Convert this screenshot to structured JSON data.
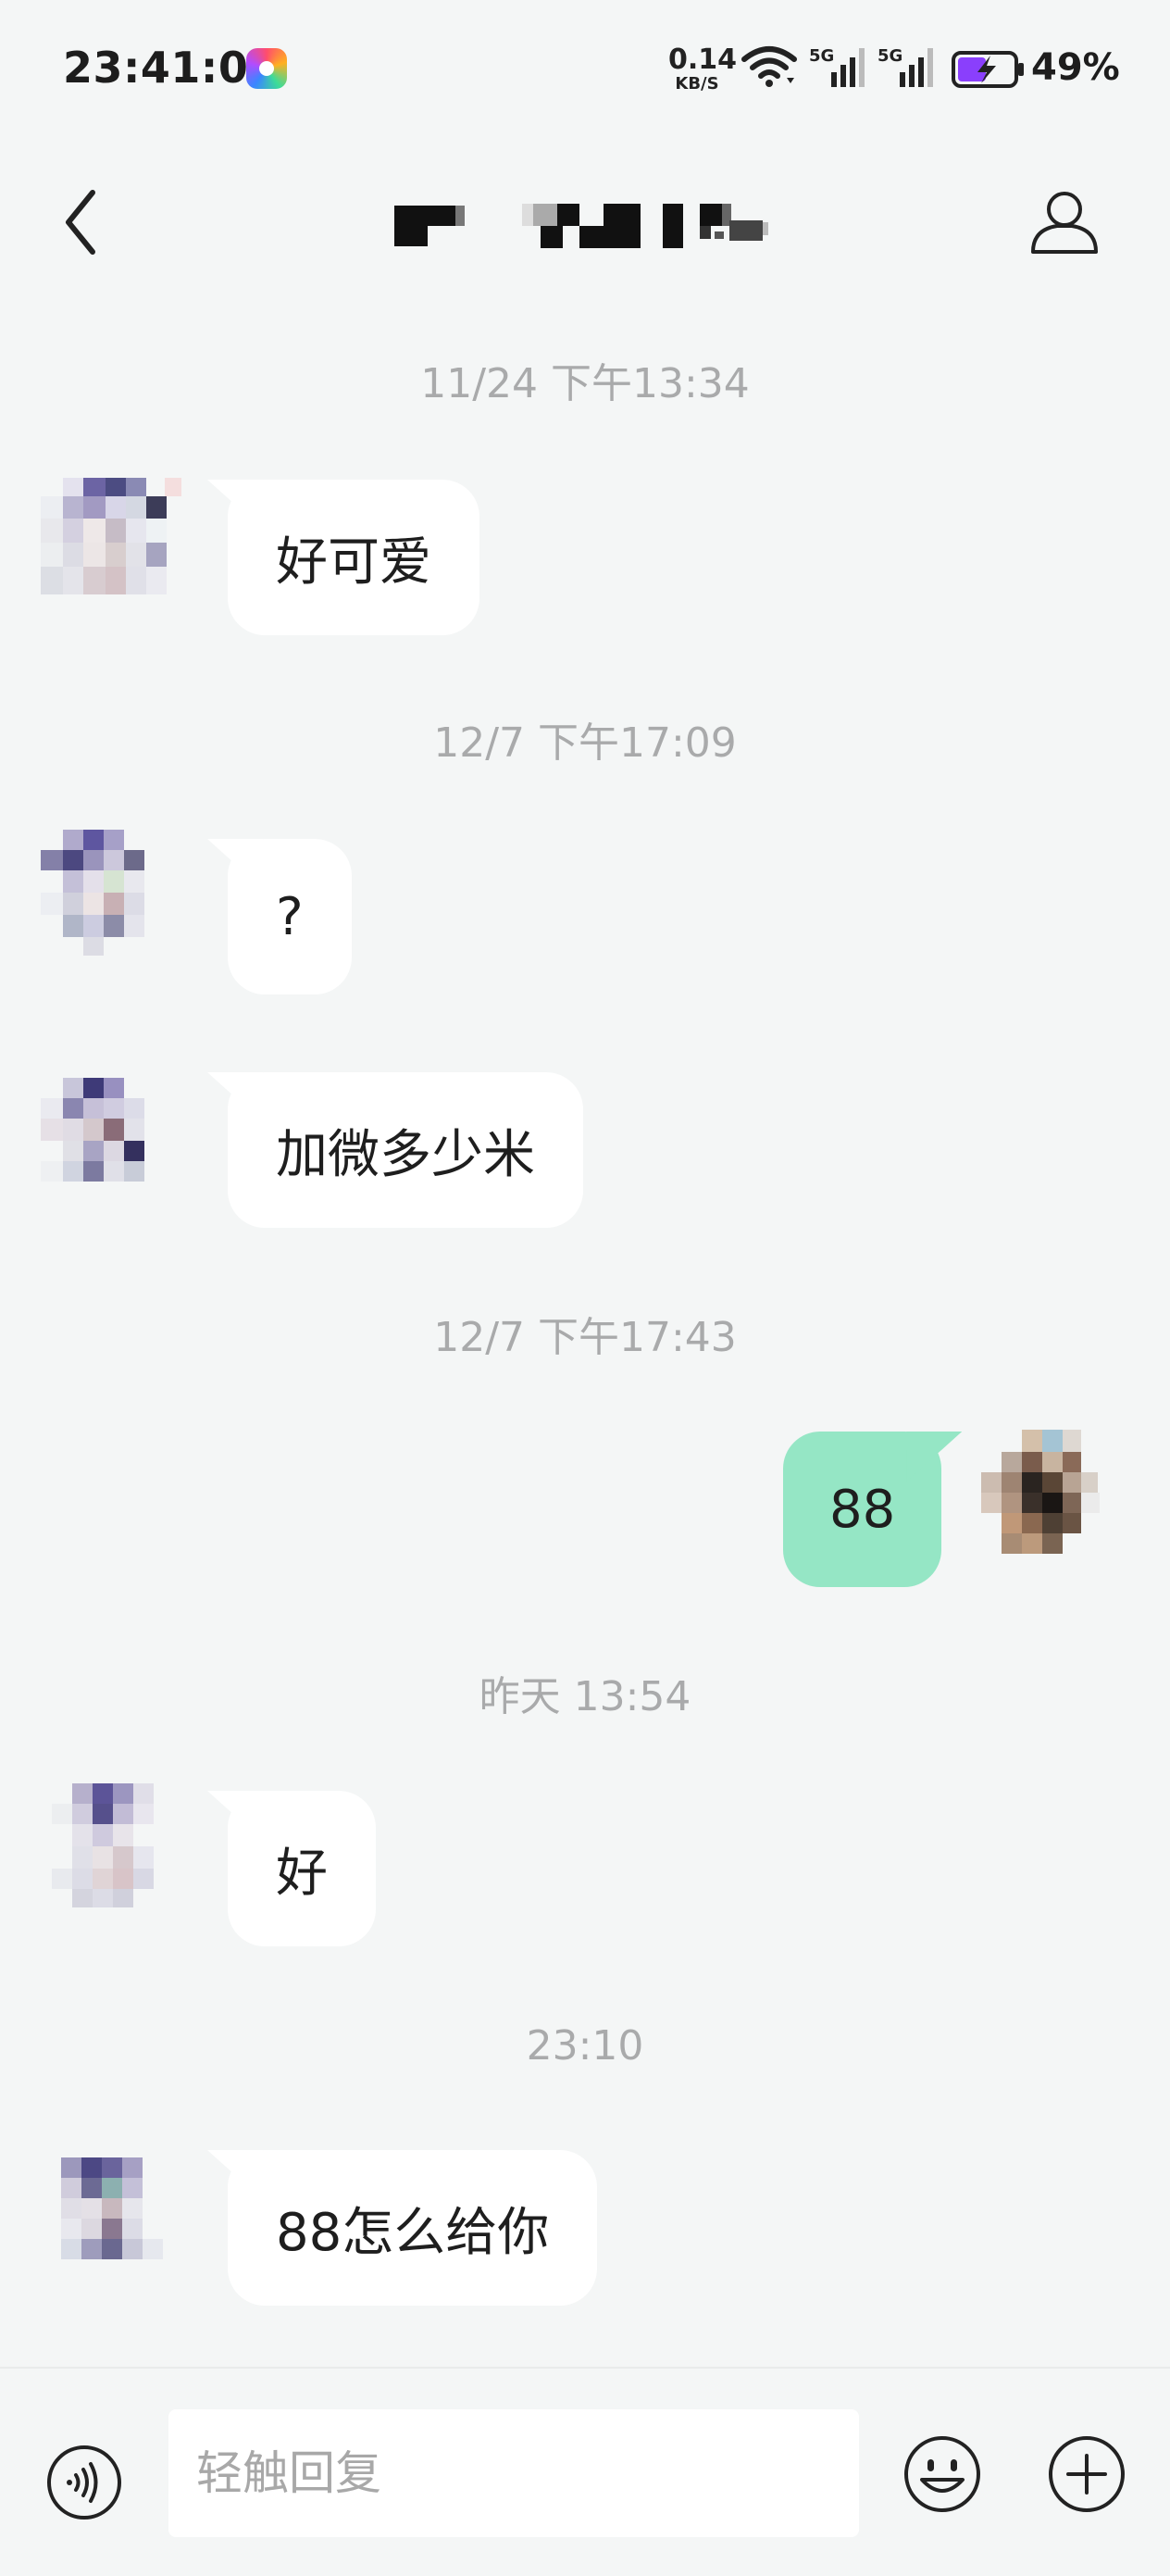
{
  "status": {
    "time": "23:41:00",
    "speed_value": "0.14",
    "speed_unit": "KB/S",
    "sig1": "5G",
    "sig2": "5G",
    "battery": "49%"
  },
  "messages": [
    {
      "timestamp": "11/24 下午13:34",
      "text": "好可爱"
    },
    {
      "timestamp": "12/7 下午17:09",
      "text": "?"
    },
    {
      "text": "加微多少米"
    },
    {
      "timestamp": "12/7 下午17:43",
      "text": "88",
      "outgoing": true
    },
    {
      "timestamp": "昨天 13:54",
      "text": "好"
    },
    {
      "timestamp": "23:10",
      "text": "88怎么给你"
    }
  ],
  "input": {
    "placeholder": "轻触回复"
  },
  "icons": {
    "back": "chevron-left-icon",
    "profile": "person-icon",
    "voice": "voice-icon",
    "emoji": "emoji-icon",
    "plus": "plus-circle-icon"
  },
  "colors": {
    "outgoing_bubble": "#95e6c5",
    "incoming_bubble": "#ffffff",
    "background": "#f4f6f6",
    "timestamp": "#a9aaab"
  }
}
